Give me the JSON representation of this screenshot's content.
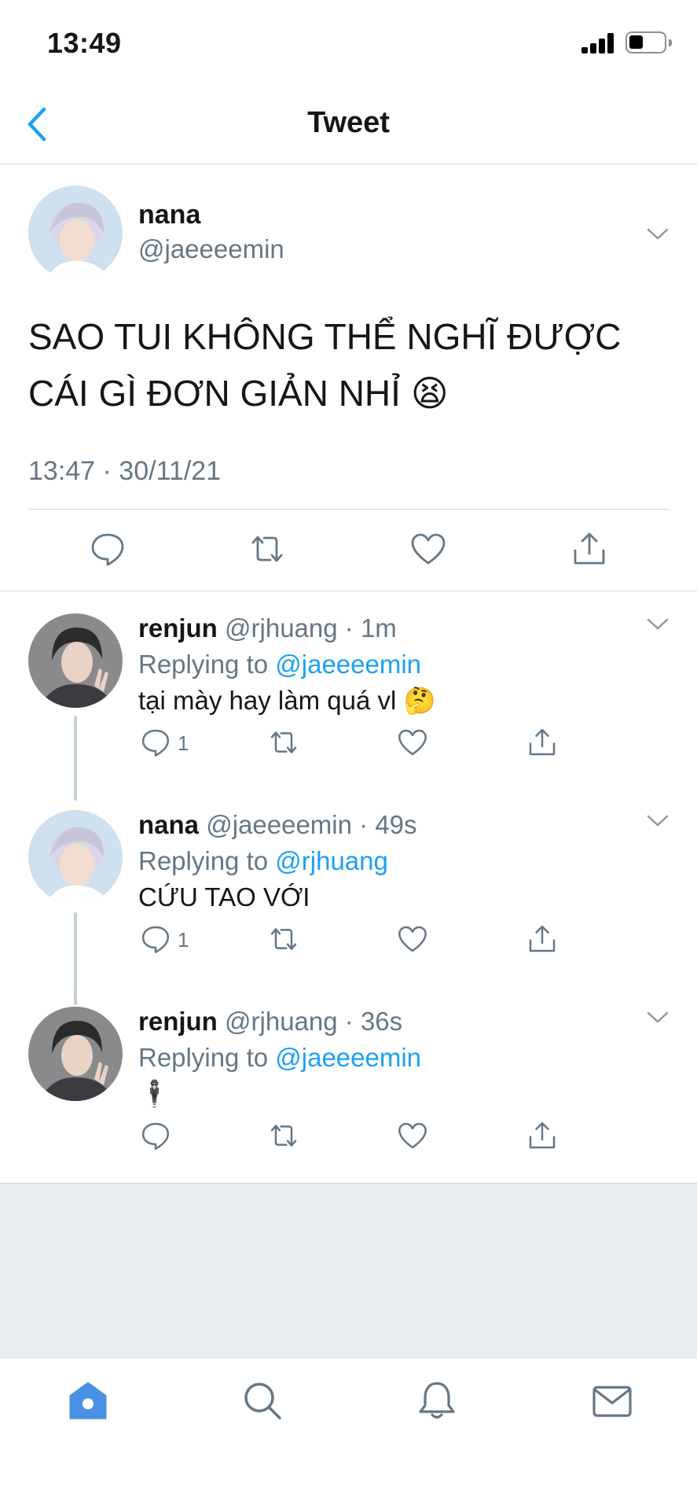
{
  "status_bar": {
    "time": "13:49"
  },
  "nav": {
    "title": "Tweet"
  },
  "main_tweet": {
    "name": "nana",
    "handle": "@jaeeeemin",
    "text": "SAO TUI KHÔNG THỂ NGHĨ ĐƯỢC CÁI GÌ ĐƠN GIẢN NHỈ 😫",
    "timestamp": "13:47 · 30/11/21"
  },
  "replies": [
    {
      "name": "renjun",
      "handle": "@rjhuang",
      "time": "· 1m",
      "replying_prefix": "Replying to ",
      "replying_to": "@jaeeeemin",
      "text": "tại mày hay làm quá vl 🤔",
      "reply_count": "1"
    },
    {
      "name": "nana",
      "handle": "@jaeeeemin",
      "time": "· 49s",
      "replying_prefix": "Replying to ",
      "replying_to": "@rjhuang",
      "text": "CỨU TAO VỚI",
      "reply_count": "1"
    },
    {
      "name": "renjun",
      "handle": "@rjhuang",
      "time": "· 36s",
      "replying_prefix": "Replying to ",
      "replying_to": "@jaeeeemin",
      "text": "🕴🏻",
      "reply_count": ""
    }
  ],
  "colors": {
    "accent": "#1da1f2",
    "tab_active": "#4a90e2",
    "secondary_text": "#657786",
    "divider": "#d5d9dd",
    "background_gray": "#e6ecf0"
  },
  "icons": {
    "back": "chevron-left-icon",
    "more": "chevron-down-icon",
    "reply": "reply-icon",
    "retweet": "retweet-icon",
    "like": "heart-icon",
    "share": "share-icon",
    "tabs": [
      "home-icon",
      "search-icon",
      "notifications-icon",
      "messages-icon"
    ]
  }
}
